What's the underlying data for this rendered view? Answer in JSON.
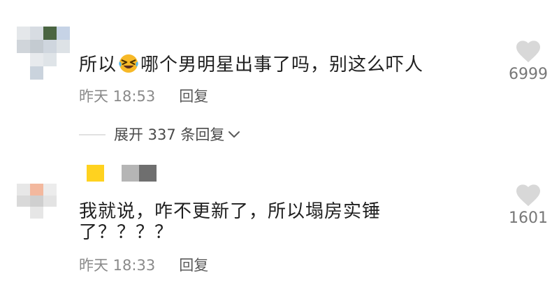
{
  "comments": [
    {
      "text_before_emoji": "所以",
      "emoji": "rolling-on-floor-laughing",
      "text_after_emoji": "哪个男明星出事了吗，别这么吓人",
      "time": "昨天 18:53",
      "reply_label": "回复",
      "likes": "6999",
      "like_icon": "heart-icon"
    },
    {
      "text_line1": "我就说，咋不更新了，所以塌房实锤",
      "text_line2": "了？？？？",
      "time": "昨天 18:33",
      "reply_label": "回复",
      "likes": "1601",
      "like_icon": "heart-icon"
    }
  ],
  "expand_replies": {
    "label": "展开 337 条回复",
    "icon": "chevron-down-icon"
  },
  "colors": {
    "text": "#1f1f1f",
    "meta": "#8a8a8a",
    "heart": "#d8d8d8",
    "mosaic_yellow": "#ffd21f"
  }
}
